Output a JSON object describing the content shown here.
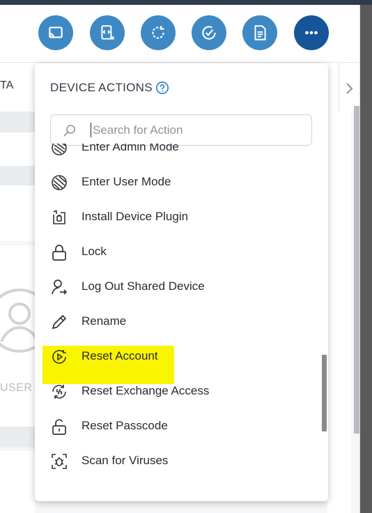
{
  "toolbar": {
    "buttons": [
      {
        "name": "cast-icon"
      },
      {
        "name": "remote-code-icon"
      },
      {
        "name": "sync-icon"
      },
      {
        "name": "check-circle-icon"
      },
      {
        "name": "document-icon"
      },
      {
        "name": "more-icon"
      }
    ],
    "accent_color": "#3e89c4",
    "active_color": "#16559a"
  },
  "background": {
    "tab_fragment": "TA",
    "user_fragment": "USER"
  },
  "dropdown": {
    "title": "DEVICE ACTIONS",
    "search_placeholder": "Search for Action",
    "items": [
      {
        "label": "Enter Admin Mode",
        "icon": "admin-mode-icon"
      },
      {
        "label": "Enter User Mode",
        "icon": "user-mode-icon"
      },
      {
        "label": "Install Device Plugin",
        "icon": "plugin-icon"
      },
      {
        "label": "Lock",
        "icon": "lock-icon"
      },
      {
        "label": "Log Out Shared Device",
        "icon": "logout-user-icon"
      },
      {
        "label": "Rename",
        "icon": "pencil-icon"
      },
      {
        "label": "Reset Account",
        "icon": "reset-account-icon",
        "highlighted": true
      },
      {
        "label": "Reset Exchange Access",
        "icon": "exchange-icon"
      },
      {
        "label": "Reset Passcode",
        "icon": "unlock-icon"
      },
      {
        "label": "Scan for Viruses",
        "icon": "scan-icon"
      }
    ],
    "highlight_color": "#f9f500"
  }
}
